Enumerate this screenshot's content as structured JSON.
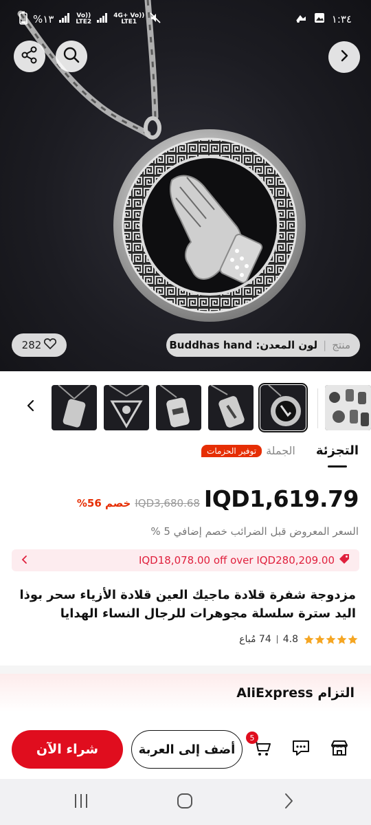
{
  "status_bar": {
    "time": "١:٣٤",
    "battery": "%١٣",
    "net1_top": "Vo))",
    "net1_bottom": "LTE2",
    "net2_top": "4G+ Vo))",
    "net2_bottom": "LTE1"
  },
  "hero": {
    "likes_count": "282",
    "variant_label": "منتج",
    "variant_value": "لون المعدن: Buddhas hand"
  },
  "tabs": {
    "retail": "التجزئة",
    "wholesale": "الجملة",
    "bulk_badge": "توفير الحزمات"
  },
  "price": {
    "current": "IQD1,619.79",
    "original": "IQD3,680.68",
    "discount": "خصم 56%",
    "tax_note": "السعر المعروض قبل الضرائب خصم إضافي 5 %"
  },
  "coupon": {
    "text": "IQD18,078.00 off over IQD280,209.00"
  },
  "product": {
    "title": "مزدوجة شفرة قلادة ماجيك العين قلادة الأزياء سحر بوذا اليد سترة سلسلة مجوهرات للرجال النساء الهدايا",
    "rating": "4.8",
    "sold": "74 مُباع"
  },
  "commitment": {
    "title": "التزام AliExpress"
  },
  "actions": {
    "buy_now": "شراء الآن",
    "add_to_cart": "أضف إلى العربة",
    "cart_count": "5"
  },
  "colors": {
    "accent": "#e00d1e",
    "discount": "#e62e04",
    "coupon_bg": "#fdecef"
  },
  "icons": [
    "share-icon",
    "search-icon",
    "forward-icon",
    "heart-icon",
    "chevron-left-icon",
    "cart-icon",
    "chat-icon",
    "store-icon",
    "nav-recents-icon",
    "nav-home-icon",
    "nav-back-icon"
  ]
}
